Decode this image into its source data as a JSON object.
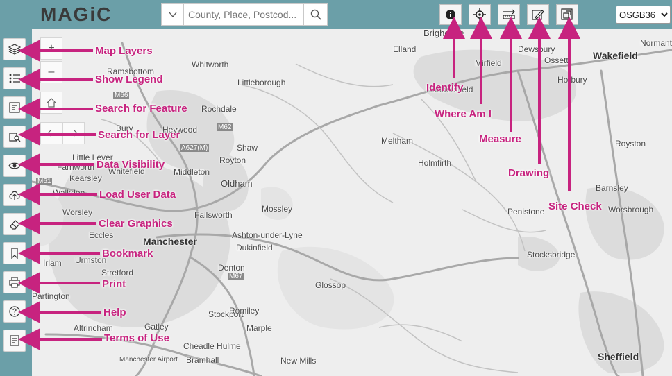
{
  "app": {
    "logo": "MAGiC"
  },
  "search": {
    "placeholder": "County, Place, Postcod..."
  },
  "crs": {
    "selected": "OSGB36"
  },
  "colors": {
    "accent": "#c7237f",
    "bar": "#6b9fa8"
  },
  "toolbar": [
    {
      "id": "identify",
      "icon": "info-icon",
      "label": "Identify"
    },
    {
      "id": "where-am-i",
      "icon": "crosshair-icon",
      "label": "Where Am I"
    },
    {
      "id": "measure",
      "icon": "ruler-icon",
      "label": "Measure"
    },
    {
      "id": "drawing",
      "icon": "pencil-icon",
      "label": "Drawing"
    },
    {
      "id": "site-check",
      "icon": "site-check-icon",
      "label": "Site Check"
    }
  ],
  "sidebar": [
    {
      "id": "map-layers",
      "icon": "layers-icon",
      "label": "Map Layers"
    },
    {
      "id": "show-legend",
      "icon": "list-icon",
      "label": "Show Legend"
    },
    {
      "id": "search-feature",
      "icon": "feature-search-icon",
      "label": "Search for Feature"
    },
    {
      "id": "search-layer",
      "icon": "layer-search-icon",
      "label": "Search for Layer"
    },
    {
      "id": "data-visibility",
      "icon": "eye-icon",
      "label": "Data Visibility"
    },
    {
      "id": "load-user-data",
      "icon": "upload-icon",
      "label": "Load User Data"
    },
    {
      "id": "clear-graphics",
      "icon": "eraser-icon",
      "label": "Clear Graphics"
    },
    {
      "id": "bookmark",
      "icon": "bookmark-icon",
      "label": "Bookmark"
    },
    {
      "id": "print",
      "icon": "printer-icon",
      "label": "Print"
    },
    {
      "id": "help",
      "icon": "help-icon",
      "label": "Help"
    },
    {
      "id": "terms",
      "icon": "document-icon",
      "label": "Terms of Use"
    }
  ],
  "map_controls": {
    "zoom_in": "+",
    "zoom_out": "–"
  },
  "places": [
    {
      "name": "Manchester",
      "size": "big"
    },
    {
      "name": "Wakefield",
      "size": "big"
    },
    {
      "name": "Sheffield",
      "size": "big"
    },
    {
      "name": "Brighouse",
      "size": "small"
    },
    {
      "name": "Elland",
      "size": "small"
    },
    {
      "name": "Dewsbury",
      "size": "small"
    },
    {
      "name": "Ossett",
      "size": "small"
    },
    {
      "name": "Normanton",
      "size": "small"
    },
    {
      "name": "Horbury",
      "size": "small"
    },
    {
      "name": "Mirfield",
      "size": "small"
    },
    {
      "name": "Huddersfield",
      "size": "small"
    },
    {
      "name": "Whitworth",
      "size": "small"
    },
    {
      "name": "Ramsbottom",
      "size": "small"
    },
    {
      "name": "Littleborough",
      "size": "small"
    },
    {
      "name": "Rochdale",
      "size": "small"
    },
    {
      "name": "Bury",
      "size": "small"
    },
    {
      "name": "Heywood",
      "size": "small"
    },
    {
      "name": "Shaw",
      "size": "small"
    },
    {
      "name": "Royton",
      "size": "small"
    },
    {
      "name": "Little Lever",
      "size": "small"
    },
    {
      "name": "Farnworth",
      "size": "small"
    },
    {
      "name": "Whitefield",
      "size": "small"
    },
    {
      "name": "Middleton",
      "size": "small"
    },
    {
      "name": "Kearsley",
      "size": "small"
    },
    {
      "name": "Oldham",
      "size": "med"
    },
    {
      "name": "Walkden",
      "size": "small"
    },
    {
      "name": "Worsley",
      "size": "small"
    },
    {
      "name": "Failsworth",
      "size": "small"
    },
    {
      "name": "Mossley",
      "size": "small"
    },
    {
      "name": "Eccles",
      "size": "small"
    },
    {
      "name": "Ashton-under-Lyne",
      "size": "small"
    },
    {
      "name": "Dukinfield",
      "size": "small"
    },
    {
      "name": "Urmston",
      "size": "small"
    },
    {
      "name": "Irlam",
      "size": "small"
    },
    {
      "name": "Denton",
      "size": "small"
    },
    {
      "name": "Stretford",
      "size": "small"
    },
    {
      "name": "Partington",
      "size": "small"
    },
    {
      "name": "Glossop",
      "size": "small"
    },
    {
      "name": "Stockport",
      "size": "small"
    },
    {
      "name": "Romiley",
      "size": "small"
    },
    {
      "name": "Marple",
      "size": "small"
    },
    {
      "name": "Altrincham",
      "size": "small"
    },
    {
      "name": "Gatley",
      "size": "small"
    },
    {
      "name": "Cheadle Hulme",
      "size": "small"
    },
    {
      "name": "Manchester Airport",
      "size": "small"
    },
    {
      "name": "Bramhall",
      "size": "small"
    },
    {
      "name": "New Mills",
      "size": "small"
    },
    {
      "name": "Meltham",
      "size": "small"
    },
    {
      "name": "Holmfirth",
      "size": "small"
    },
    {
      "name": "Penistone",
      "size": "small"
    },
    {
      "name": "Stocksbridge",
      "size": "small"
    },
    {
      "name": "Royston",
      "size": "small"
    },
    {
      "name": "Barnsley",
      "size": "small"
    },
    {
      "name": "Worsbrough",
      "size": "small"
    }
  ],
  "roads": [
    "M66",
    "M62",
    "A627(M)",
    "M61",
    "M67"
  ]
}
